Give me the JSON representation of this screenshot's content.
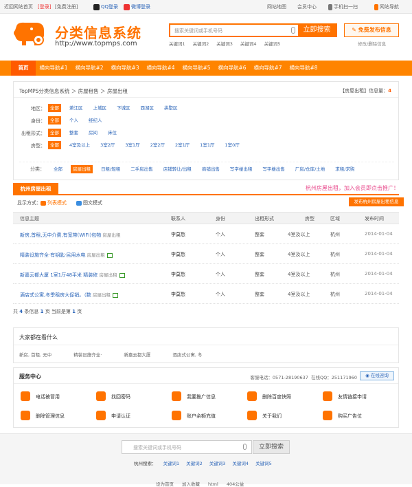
{
  "topbar": {
    "left_text": "近回网站首页",
    "login": "[登录]",
    "register": "[免费注册]",
    "qq_login": "QQ登录",
    "weibo_login": "微博登录",
    "site_map": "网站地图",
    "member_center": "会员中心",
    "mobile": "手机扫一扫",
    "site_nav": "网站导航"
  },
  "header": {
    "logo_title": "分类信息系统",
    "logo_url": "http://www.topmps.com",
    "search_placeholder": "搜索关键词或手机号码",
    "search_button": "立即搜索",
    "hotwords": [
      "关键词1",
      "关键词2",
      "关键词3",
      "关键词4",
      "关键词5"
    ],
    "post_button": "免费发布信息",
    "edit_link": "修改/删除信息"
  },
  "nav": {
    "items": [
      "首页",
      "横向导航#1",
      "横向导航#2",
      "横向导航#3",
      "横向导航#4",
      "横向导航#5",
      "横向导航#6",
      "横向导航#7",
      "横向导航#8"
    ]
  },
  "breadcrumb": {
    "text": "TopMPS分类信息系统 ＞ 房屋租售 ＞ 房屋出租",
    "right_label": "【房屋出租】信息量：",
    "right_count": "4"
  },
  "filters": {
    "area_label": "地区：",
    "area": [
      "全部",
      "萧江区",
      "上城区",
      "下城区",
      "西湖区",
      "拱墅区"
    ],
    "identity_label": "身份：",
    "identity": [
      "全部",
      "个人",
      "经纪人"
    ],
    "rent_label": "出租形式：",
    "rent": [
      "全部",
      "整套",
      "房间",
      "床位"
    ],
    "type_label": "房型：",
    "type": [
      "全部",
      "4室及以上",
      "3室2厅",
      "3室1厅",
      "2室2厅",
      "2室1厅",
      "1室1厅",
      "1室0厅"
    ],
    "category_label": "分类：",
    "category": [
      "全部",
      "房屋出租",
      "日租/短租",
      "二手房出售",
      "店铺转让/出租",
      "商铺出售",
      "写字楼出租",
      "写字楼出售",
      "厂房/仓库/土地",
      "求租/求购"
    ]
  },
  "listing": {
    "tab": "杭州房屋出租",
    "promo": "杭州房屋出租，加入会员即点击推广！",
    "mode_label": "显示方式：",
    "mode_list": "列表模式",
    "mode_image": "图文模式",
    "publish_button": "发布杭州房屋出租信息",
    "columns": [
      "信息主题",
      "联系人",
      "身份",
      "出租形式",
      "房型",
      "区域",
      "发布时间"
    ],
    "rows": [
      {
        "title": "新房,首租,无中介费,有宽带(WIFI)包物",
        "tag": "房屋出租",
        "has_img": false,
        "contact": "李莫愁",
        "identity": "个人",
        "rent": "整套",
        "type": "4室及以上",
        "area": "杭州",
        "date": "2014-01-04"
      },
      {
        "title": "精装设施齐全·有钥匙·民用水电",
        "tag": "房屋出租",
        "has_img": true,
        "contact": "李莫愁",
        "identity": "个人",
        "rent": "整套",
        "type": "4室及以上",
        "area": "杭州",
        "date": "2014-01-04"
      },
      {
        "title": "新嘉云都大厦 1室1厅48平米 精装修",
        "tag": "房屋出租",
        "has_img": true,
        "contact": "李莫愁",
        "identity": "个人",
        "rent": "整套",
        "type": "4室及以上",
        "area": "杭州",
        "date": "2014-01-04"
      },
      {
        "title": "酒店式公寓,冬季租房大促销。（数",
        "tag": "房屋出租",
        "has_img": true,
        "contact": "李莫愁",
        "identity": "个人",
        "rent": "整套",
        "type": "4室及以上",
        "area": "杭州",
        "date": "2014-01-04"
      }
    ],
    "pager": {
      "prefix": "共",
      "total": "4",
      "mid1": "条信息",
      "pages": "1",
      "mid2": "页 当前是第",
      "current": "1",
      "suffix": "页"
    }
  },
  "watching": {
    "title": "大家都在看什么",
    "items": [
      "新房, 首租, 无中",
      "精装设施齐全·",
      "新嘉云都大厦",
      "酒店式公寓, 冬"
    ]
  },
  "service": {
    "title": "服务中心",
    "phone": "客服电话：0571-28190637",
    "qq": "在线QQ：251171960",
    "online": "在线咨询",
    "items": [
      "电话被冒用",
      "找回密码",
      "我要推广信息",
      "删除百度快照",
      "友情链接申请",
      "删除管理信息",
      "申请认证",
      "账户余额充值",
      "关于我们",
      "购买广告位"
    ],
    "colors": [
      "#ff7300",
      "#ff7300",
      "#ff7300",
      "#ff7300",
      "#ff7300",
      "#ff7300",
      "#ff7300",
      "#ff7300",
      "#ff7300",
      "#ff7300"
    ]
  },
  "footer": {
    "search_placeholder": "搜索关键词或手机号码",
    "search_button": "立即搜索",
    "hot_label": "杭州搜索：",
    "hotwords": [
      "关键词1",
      "关键词2",
      "关键词3",
      "关键词4",
      "关键词5"
    ],
    "links": [
      "设为首页",
      "加入收藏",
      "html",
      "404公益"
    ]
  },
  "colors": {
    "accent": "#ff7300",
    "nav": "#ff8400",
    "link": "#2a64b8"
  }
}
